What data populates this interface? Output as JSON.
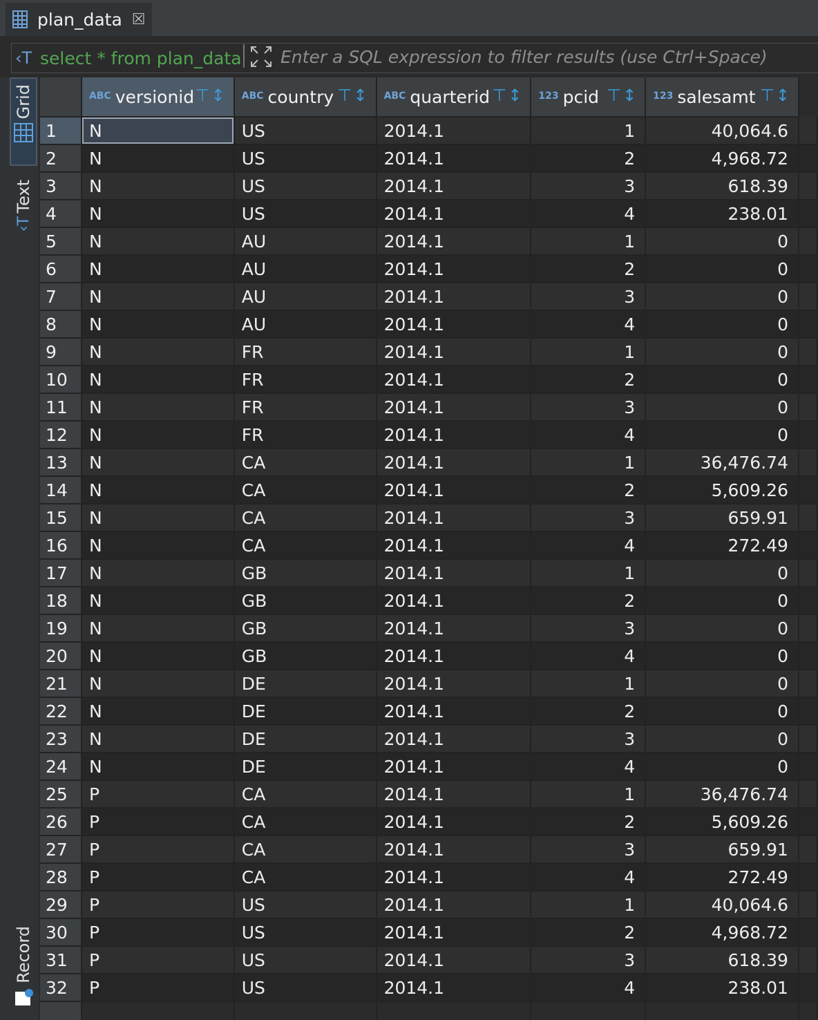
{
  "tab": {
    "title": "plan_data",
    "close_glyph": "☒"
  },
  "filter": {
    "query": "select * from plan_data",
    "placeholder": "Enter a SQL expression to filter results (use Ctrl+Space)"
  },
  "side_tabs": {
    "grid": "Grid",
    "text": "Text",
    "record": "Record"
  },
  "columns": [
    {
      "name": "versionid",
      "type": "ABC"
    },
    {
      "name": "country",
      "type": "ABC"
    },
    {
      "name": "quarterid",
      "type": "ABC"
    },
    {
      "name": "pcid",
      "type": "123"
    },
    {
      "name": "salesamt",
      "type": "123"
    }
  ],
  "rows": [
    [
      "1",
      "N",
      "US",
      "2014.1",
      "1",
      "40,064.6"
    ],
    [
      "2",
      "N",
      "US",
      "2014.1",
      "2",
      "4,968.72"
    ],
    [
      "3",
      "N",
      "US",
      "2014.1",
      "3",
      "618.39"
    ],
    [
      "4",
      "N",
      "US",
      "2014.1",
      "4",
      "238.01"
    ],
    [
      "5",
      "N",
      "AU",
      "2014.1",
      "1",
      "0"
    ],
    [
      "6",
      "N",
      "AU",
      "2014.1",
      "2",
      "0"
    ],
    [
      "7",
      "N",
      "AU",
      "2014.1",
      "3",
      "0"
    ],
    [
      "8",
      "N",
      "AU",
      "2014.1",
      "4",
      "0"
    ],
    [
      "9",
      "N",
      "FR",
      "2014.1",
      "1",
      "0"
    ],
    [
      "10",
      "N",
      "FR",
      "2014.1",
      "2",
      "0"
    ],
    [
      "11",
      "N",
      "FR",
      "2014.1",
      "3",
      "0"
    ],
    [
      "12",
      "N",
      "FR",
      "2014.1",
      "4",
      "0"
    ],
    [
      "13",
      "N",
      "CA",
      "2014.1",
      "1",
      "36,476.74"
    ],
    [
      "14",
      "N",
      "CA",
      "2014.1",
      "2",
      "5,609.26"
    ],
    [
      "15",
      "N",
      "CA",
      "2014.1",
      "3",
      "659.91"
    ],
    [
      "16",
      "N",
      "CA",
      "2014.1",
      "4",
      "272.49"
    ],
    [
      "17",
      "N",
      "GB",
      "2014.1",
      "1",
      "0"
    ],
    [
      "18",
      "N",
      "GB",
      "2014.1",
      "2",
      "0"
    ],
    [
      "19",
      "N",
      "GB",
      "2014.1",
      "3",
      "0"
    ],
    [
      "20",
      "N",
      "GB",
      "2014.1",
      "4",
      "0"
    ],
    [
      "21",
      "N",
      "DE",
      "2014.1",
      "1",
      "0"
    ],
    [
      "22",
      "N",
      "DE",
      "2014.1",
      "2",
      "0"
    ],
    [
      "23",
      "N",
      "DE",
      "2014.1",
      "3",
      "0"
    ],
    [
      "24",
      "N",
      "DE",
      "2014.1",
      "4",
      "0"
    ],
    [
      "25",
      "P",
      "CA",
      "2014.1",
      "1",
      "36,476.74"
    ],
    [
      "26",
      "P",
      "CA",
      "2014.1",
      "2",
      "5,609.26"
    ],
    [
      "27",
      "P",
      "CA",
      "2014.1",
      "3",
      "659.91"
    ],
    [
      "28",
      "P",
      "CA",
      "2014.1",
      "4",
      "272.49"
    ],
    [
      "29",
      "P",
      "US",
      "2014.1",
      "1",
      "40,064.6"
    ],
    [
      "30",
      "P",
      "US",
      "2014.1",
      "2",
      "4,968.72"
    ],
    [
      "31",
      "P",
      "US",
      "2014.1",
      "3",
      "618.39"
    ],
    [
      "32",
      "P",
      "US",
      "2014.1",
      "4",
      "238.01"
    ]
  ]
}
